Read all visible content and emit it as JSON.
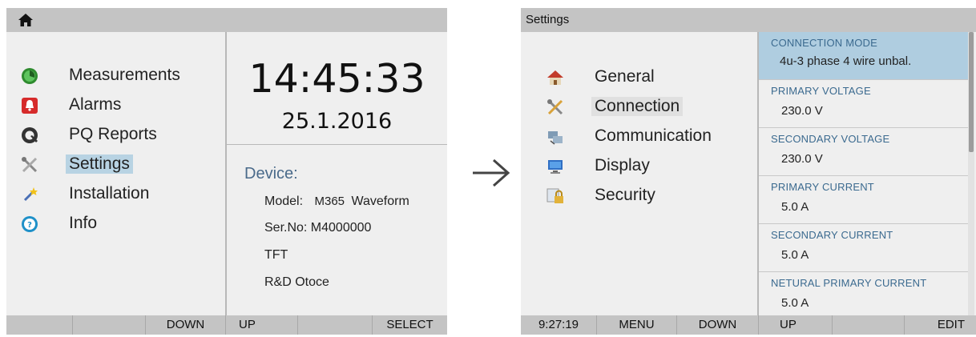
{
  "left_screen": {
    "menu": [
      {
        "label": "Measurements",
        "icon": "measurements-icon"
      },
      {
        "label": "Alarms",
        "icon": "alarm-bell-icon"
      },
      {
        "label": "PQ Reports",
        "icon": "pq-reports-icon"
      },
      {
        "label": "Settings",
        "icon": "wrench-screwdriver-icon",
        "selected": true
      },
      {
        "label": "Installation",
        "icon": "magic-wand-icon"
      },
      {
        "label": "Info",
        "icon": "info-icon"
      }
    ],
    "clock": {
      "time": "14:45:33",
      "date": "25.1.2016"
    },
    "device": {
      "title": "Device:",
      "model_label": "Model:",
      "model_value": "M365",
      "model_variant": "Waveform",
      "serial": "Ser.No: M4000000",
      "display": "TFT",
      "location": "R&D Otoce"
    },
    "softkeys": [
      "",
      "",
      "DOWN",
      "UP",
      "",
      "SELECT"
    ]
  },
  "right_screen": {
    "title": "Settings",
    "menu": [
      {
        "label": "General",
        "icon": "house-icon"
      },
      {
        "label": "Connection",
        "icon": "wrench-screwdriver-icon",
        "selected": true
      },
      {
        "label": "Communication",
        "icon": "network-icon"
      },
      {
        "label": "Display",
        "icon": "monitor-icon"
      },
      {
        "label": "Security",
        "icon": "padlock-icon"
      }
    ],
    "params": [
      {
        "label": "CONNECTION MODE",
        "value": "4u-3 phase 4 wire unbal.",
        "selected": true
      },
      {
        "label": "PRIMARY VOLTAGE",
        "value": "230.0 V"
      },
      {
        "label": "SECONDARY VOLTAGE",
        "value": "230.0 V"
      },
      {
        "label": "PRIMARY CURRENT",
        "value": "5.0 A"
      },
      {
        "label": "SECONDARY CURRENT",
        "value": "5.0 A"
      },
      {
        "label": "NETURAL PRIMARY CURRENT",
        "value": "5.0 A"
      }
    ],
    "softkeys": [
      "9:27:19",
      "MENU",
      "DOWN",
      "UP",
      "",
      "EDIT"
    ]
  },
  "colors": {
    "selection": "#b8d3e3",
    "param_highlight": "#afcde0",
    "bar": "#c4c4c4",
    "device_title": "#4a6a8a"
  }
}
